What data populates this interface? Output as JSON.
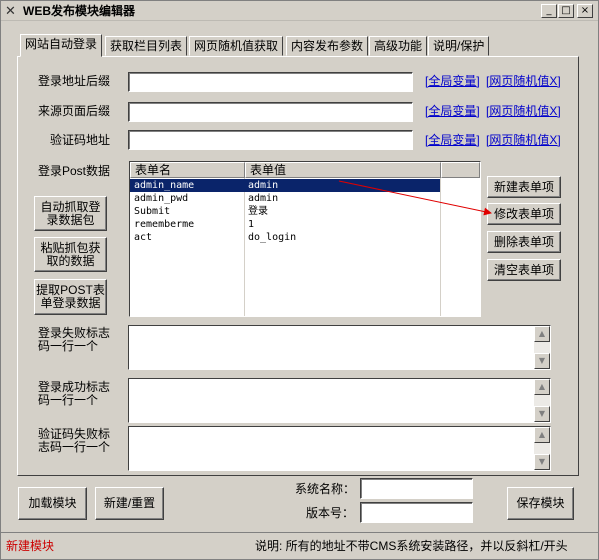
{
  "window": {
    "title": "WEB发布模块编辑器"
  },
  "title_buttons": {
    "minimize": "_",
    "maximize": "□",
    "close": "×"
  },
  "tabs": [
    {
      "label": "网站自动登录",
      "active": true
    },
    {
      "label": "获取栏目列表"
    },
    {
      "label": "网页随机值获取"
    },
    {
      "label": "内容发布参数"
    },
    {
      "label": "高级功能"
    },
    {
      "label": "说明/保护"
    }
  ],
  "form": {
    "login_url_label": "登录地址后缀",
    "login_url_value": "",
    "referer_label": "来源页面后缀",
    "referer_value": "",
    "captcha_label": "验证码地址",
    "captcha_value": "",
    "global_var_link": "[全局变量]",
    "random_val_link": "[网页随机值X]",
    "post_data_label": "登录Post数据"
  },
  "post_table": {
    "headers": [
      "表单名",
      "表单值"
    ],
    "rows": [
      {
        "name": "admin_name",
        "value": "admin",
        "selected": true
      },
      {
        "name": "admin_pwd",
        "value": "admin"
      },
      {
        "name": "Submit",
        "value": "登录"
      },
      {
        "name": "rememberme",
        "value": "1"
      },
      {
        "name": "act",
        "value": "do_login"
      }
    ]
  },
  "left_buttons": {
    "capture": "自动抓取登\n录数据包",
    "paste": "粘贴抓包获\n取的数据",
    "extract": "提取POST表\n单登录数据"
  },
  "right_buttons": {
    "new_item": "新建表单项",
    "edit_item": "修改表单项",
    "delete_item": "删除表单项",
    "clear_items": "清空表单项"
  },
  "memos": {
    "fail_label": "登录失败标志\n码一行一个",
    "success_label": "登录成功标志\n码一行一个",
    "captcha_fail_label": "验证码失败标\n志码一行一个"
  },
  "bottom": {
    "load_button": "加载模块",
    "new_reset_button": "新建/重置",
    "system_name_label": "系统名称：",
    "system_name_value": "",
    "version_label": "版本号：",
    "version_value": "",
    "save_button": "保存模块"
  },
  "status": {
    "left": "新建模块",
    "right": "说明:  所有的地址不带CMS系统安装路径，并以反斜杠/开头"
  },
  "colors": {
    "selection": "#0a246a",
    "link": "#0000cc",
    "status_red": "#cc0000",
    "arrow": "#e00000"
  },
  "icons": {
    "app": "tools-icon"
  }
}
